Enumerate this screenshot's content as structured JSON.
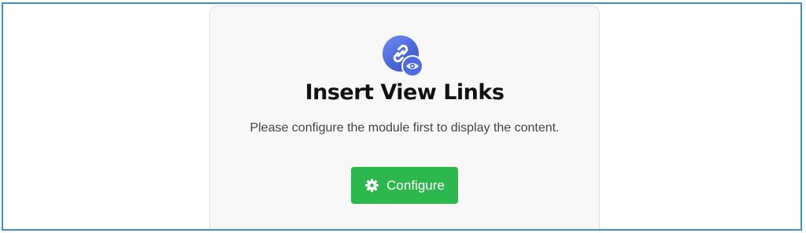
{
  "module": {
    "icon": "link-eye-icon",
    "title": "Insert View Links",
    "message": "Please configure the module first to display the content."
  },
  "configure_button": {
    "label": "Configure",
    "icon": "gear-icon",
    "color": "#2db84d"
  },
  "colors": {
    "frame_border": "#3f8fd3",
    "card_background": "#f8f8f8",
    "icon_blue": "#4f6be0"
  }
}
